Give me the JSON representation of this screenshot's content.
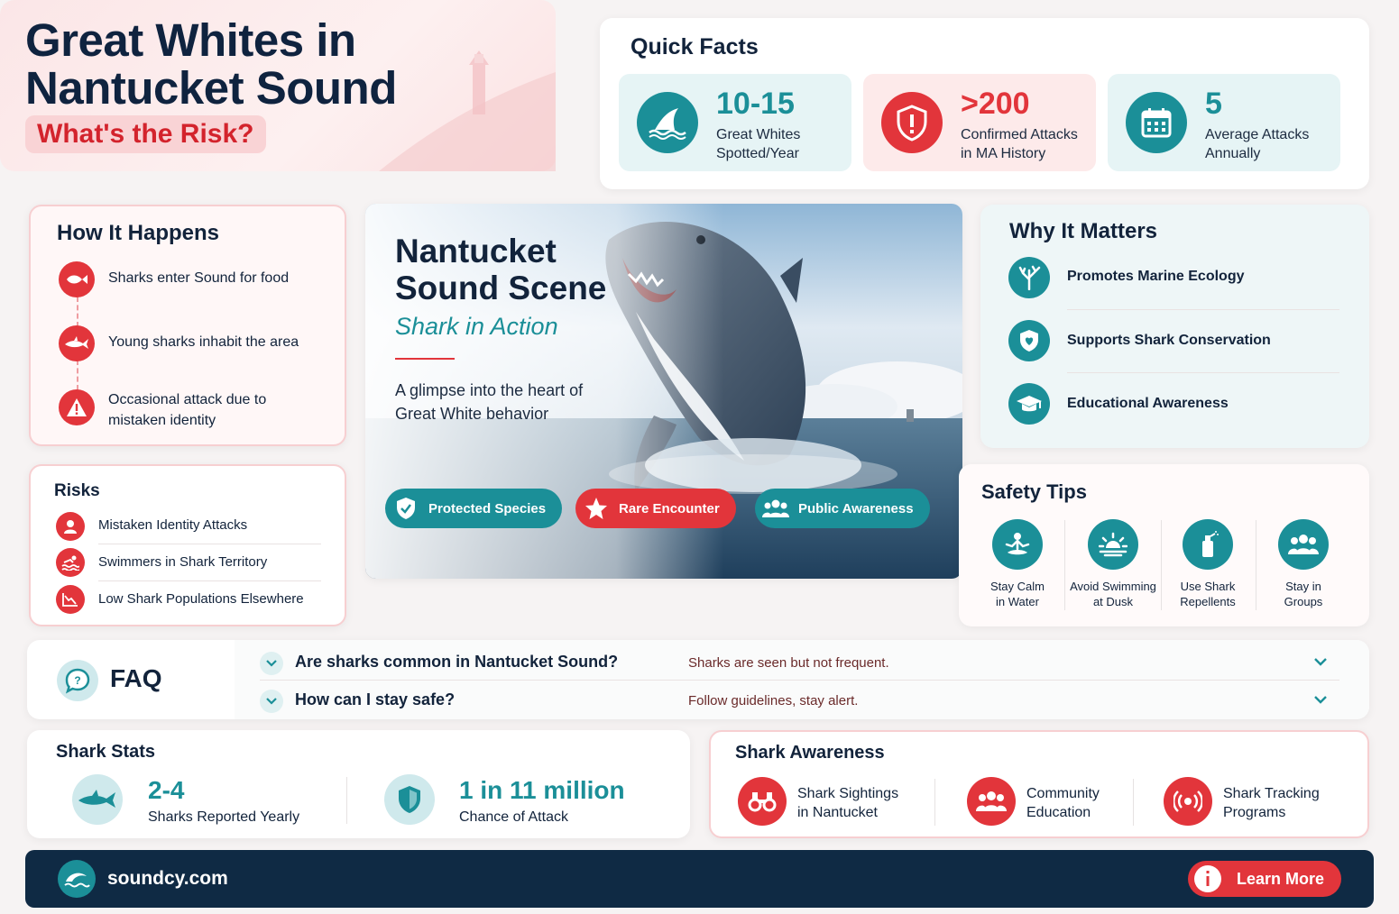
{
  "header": {
    "title_line1": "Great Whites in",
    "title_line2": "Nantucket Sound",
    "subtitle": "What's the Risk?"
  },
  "quick_facts": {
    "title": "Quick Facts",
    "items": [
      {
        "value": "10-15",
        "label_line1": "Great Whites",
        "label_line2": "Spotted/Year",
        "icon": "shark-fin-icon"
      },
      {
        "value": ">200",
        "label_line1": "Confirmed Attacks",
        "label_line2": "in MA History",
        "icon": "shield-alert-icon"
      },
      {
        "value": "5",
        "label_line1": "Average Attacks",
        "label_line2": "Annually",
        "icon": "calendar-icon"
      }
    ]
  },
  "how_it_happens": {
    "title": "How It Happens",
    "steps": [
      {
        "line1": "Sharks enter Sound for food",
        "line2": "",
        "icon": "fish-icon"
      },
      {
        "line1": "Young sharks inhabit the area",
        "line2": "",
        "icon": "shark-icon"
      },
      {
        "line1": "Occasional attack due to",
        "line2": "mistaken identity",
        "icon": "warning-icon"
      }
    ]
  },
  "scene": {
    "title_line1": "Nantucket",
    "title_line2": "Sound Scene",
    "subtitle": "Shark in Action",
    "desc_line1": "A glimpse into the heart of",
    "desc_line2": "Great White behavior",
    "chips": [
      "Protected Species",
      "Rare Encounter",
      "Public Awareness"
    ]
  },
  "why_it_matters": {
    "title": "Why It Matters",
    "items": [
      "Promotes Marine Ecology",
      "Supports Shark Conservation",
      "Educational Awareness"
    ]
  },
  "risks": {
    "title": "Risks",
    "items": [
      "Mistaken Identity Attacks",
      "Swimmers in Shark Territory",
      "Low Shark Populations Elsewhere"
    ]
  },
  "safety_tips": {
    "title": "Safety Tips",
    "items": [
      {
        "line1": "Stay Calm",
        "line2": "in Water"
      },
      {
        "line1": "Avoid Swimming",
        "line2": "at Dusk"
      },
      {
        "line1": "Use Shark",
        "line2": "Repellents"
      },
      {
        "line1": "Stay in",
        "line2": "Groups"
      }
    ]
  },
  "faq": {
    "title": "FAQ",
    "items": [
      {
        "q": "Are sharks common in Nantucket Sound?",
        "a": "Sharks are seen but not frequent."
      },
      {
        "q": "How can I stay safe?",
        "a": "Follow guidelines, stay alert."
      }
    ]
  },
  "shark_stats": {
    "title": "Shark Stats",
    "items": [
      {
        "value": "2-4",
        "label": "Sharks Reported Yearly"
      },
      {
        "value": "1 in 11 million",
        "label": "Chance of Attack"
      }
    ]
  },
  "shark_awareness": {
    "title": "Shark Awareness",
    "items": [
      {
        "line1": "Shark Sightings",
        "line2": "in Nantucket"
      },
      {
        "line1": "Community",
        "line2": "Education"
      },
      {
        "line1": "Shark Tracking",
        "line2": "Programs"
      }
    ]
  },
  "footer": {
    "site": "soundcy.com",
    "cta": "Learn More"
  },
  "colors": {
    "navy": "#12233b",
    "teal": "#1b8f98",
    "red": "#e2353b",
    "footer_bg": "#0f2a44"
  }
}
